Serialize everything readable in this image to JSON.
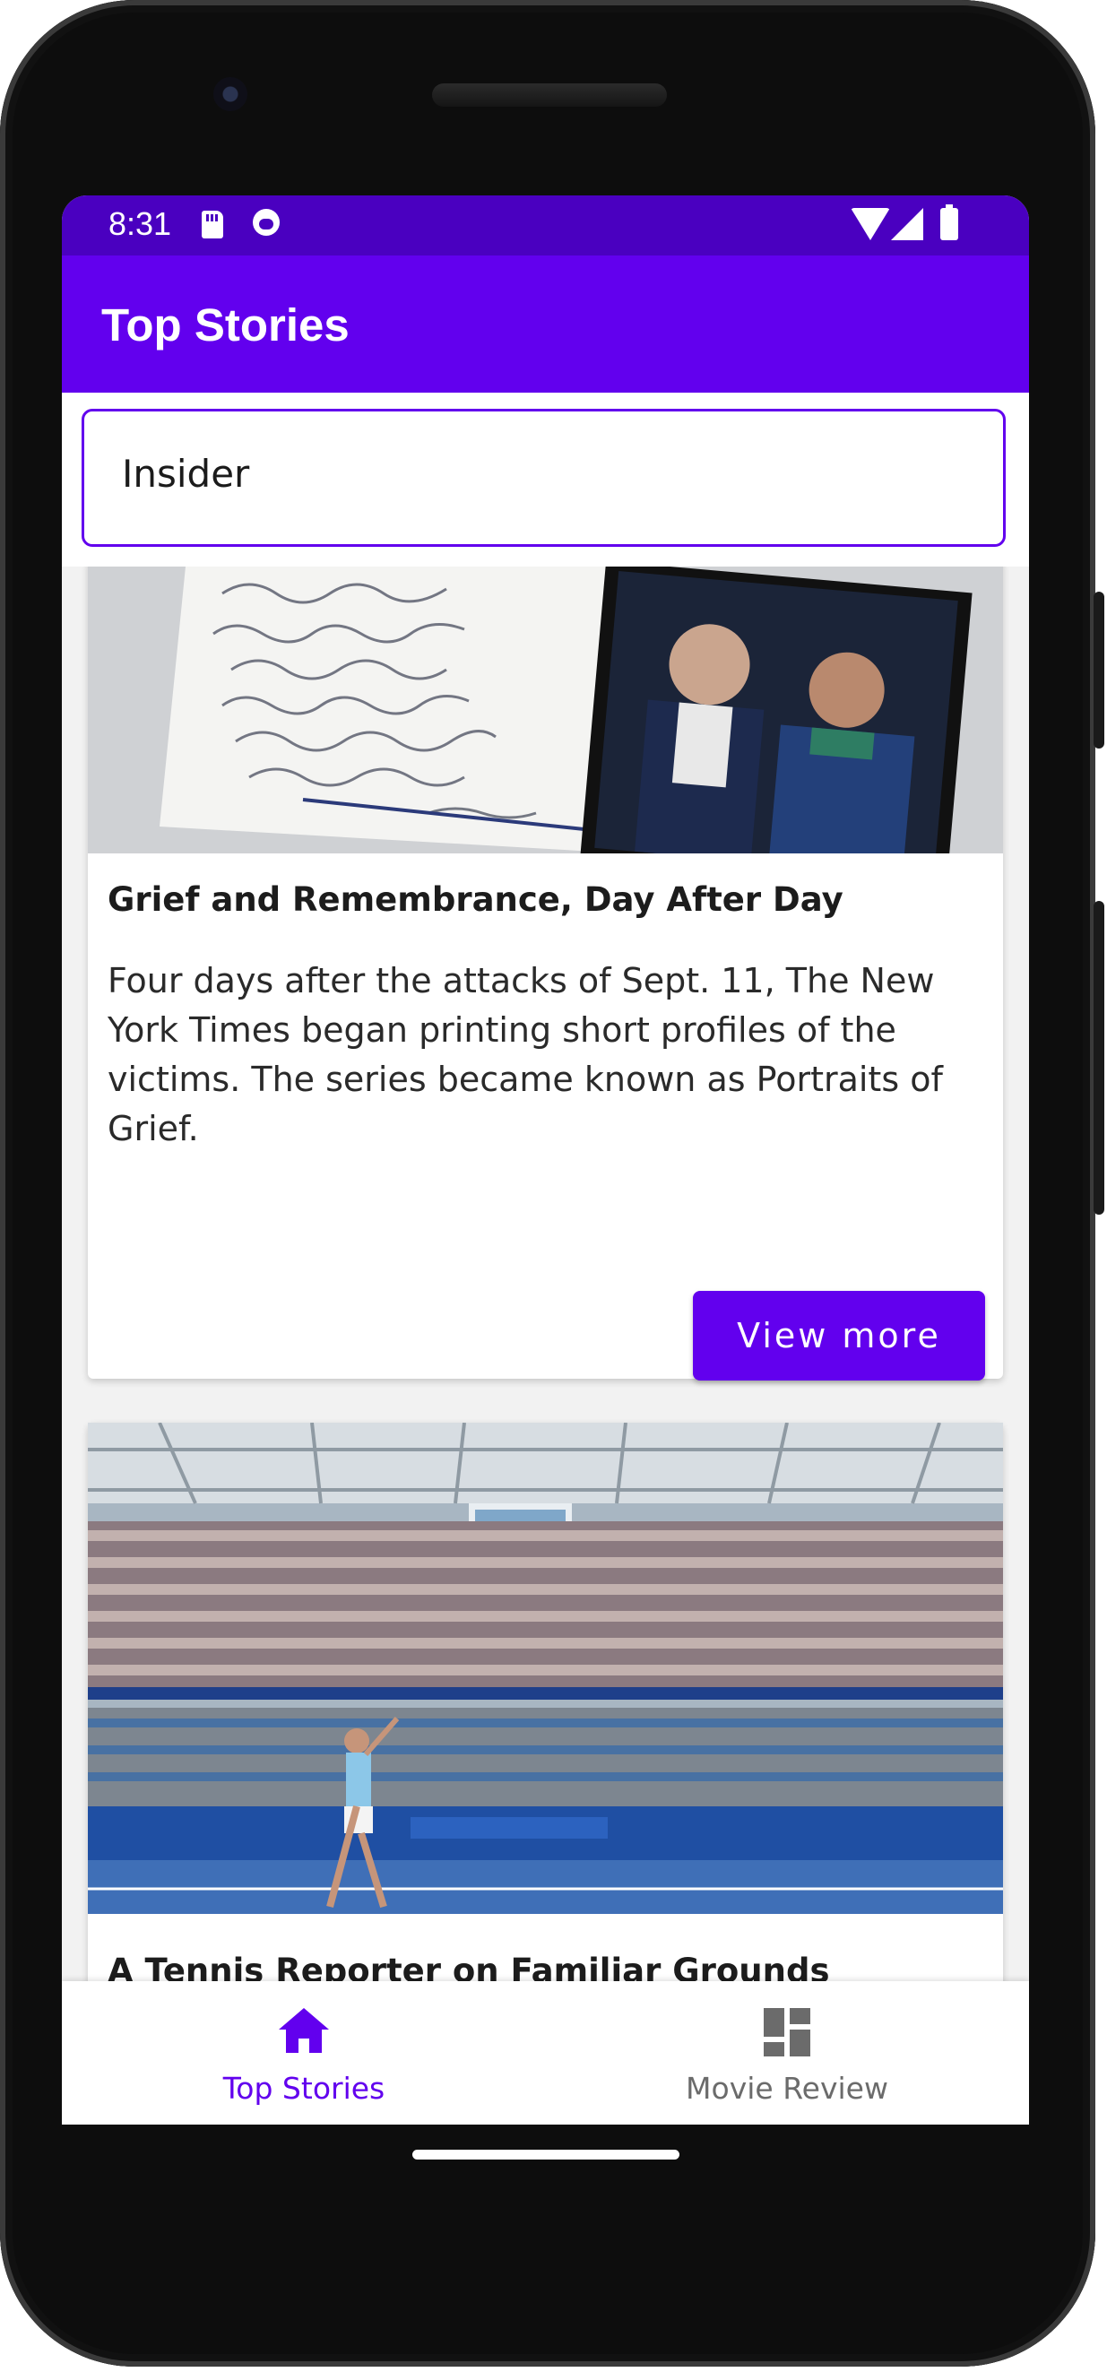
{
  "status_bar": {
    "time": "8:31"
  },
  "app_bar": {
    "title": "Top Stories"
  },
  "search": {
    "value": "Insider"
  },
  "articles": [
    {
      "title": "Grief and Remembrance, Day After Day",
      "abstract": "Four days after the attacks of Sept. 11, The New York Times began printing short profiles of the victims. The series became known as Portraits of Grief.",
      "button_label": "View more"
    },
    {
      "title": "A Tennis Reporter on Familiar Grounds"
    }
  ],
  "bottom_nav": {
    "items": [
      {
        "label": "Top Stories",
        "icon": "home-icon",
        "active": true
      },
      {
        "label": "Movie Review",
        "icon": "dashboard-icon",
        "active": false
      }
    ]
  },
  "colors": {
    "primary": "#6200ee",
    "status_bar": "#4a00c0",
    "inactive": "#6b6b6b"
  }
}
